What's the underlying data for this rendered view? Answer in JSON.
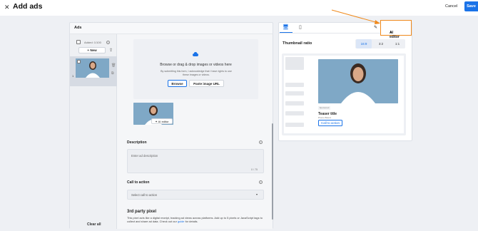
{
  "header": {
    "close_icon": "close-icon",
    "title": "Add ads",
    "cancel": "Cancel",
    "save": "Save"
  },
  "ads": {
    "panel_title": "Ads",
    "added_count": "Added: 1/100",
    "new_button": "New",
    "item_number": "1",
    "clear_all": "Clear all"
  },
  "editor": {
    "drop_main": "Browse or drag & drop images or videos here",
    "drop_sub": "By submitting this form, I acknowledge that I have rights to use these images or videos.",
    "browse": "Browse",
    "paste_url": "Paste image URL",
    "ai_editor_small": "AI editor",
    "description_label": "Description",
    "description_placeholder": "Enter ad description",
    "description_count": "0 / 75",
    "cta_label": "Call to action",
    "cta_placeholder": "Select call to action",
    "pixel_label": "3rd party pixel",
    "pixel_text_1": "This pixel acts like a digital receipt, tracking ad views across platforms. Add up to 5 pixels or JavaScript tags to collect and share ad data. Check out our ",
    "pixel_link": "guide",
    "pixel_text_2": " for details."
  },
  "preview": {
    "ai_editor": "AI editor",
    "thumbnail_ratio": "Thumbnail ratio",
    "ratios": [
      "16:9",
      "3:2",
      "1:1"
    ],
    "active_ratio": "16:9",
    "sponsored": "Sponsored",
    "teaser_title": "Teaser title",
    "teaser_sub": "Promo Brand",
    "cta": "Call to action"
  },
  "colors": {
    "accent": "#1a73e8",
    "highlight": "#f08a1c"
  }
}
